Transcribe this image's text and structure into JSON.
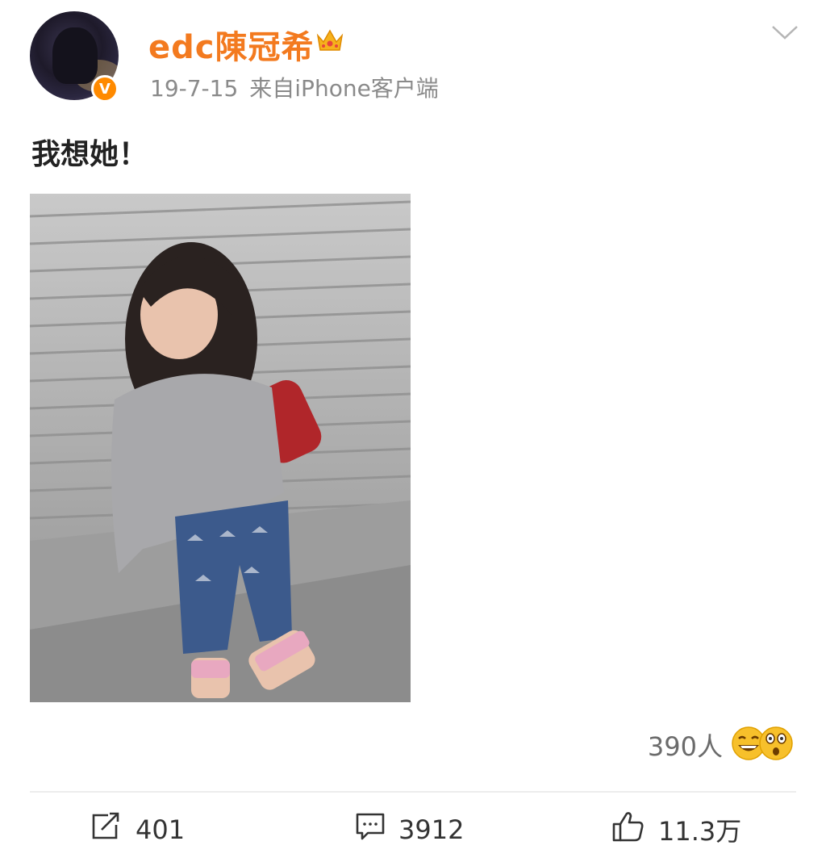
{
  "post": {
    "username": "edc陳冠希",
    "date": "19-7-15",
    "source": "来自iPhone客户端",
    "text": "我想她！",
    "verified_badge": "V",
    "icons": [
      "crown-icon",
      "verified-badge",
      "chevron-down-icon"
    ]
  },
  "reactions": {
    "count_label": "390人",
    "icons": [
      "grin-emoji-icon",
      "surprised-emoji-icon"
    ]
  },
  "actions": {
    "repost": {
      "icon": "repost-icon",
      "count": "401"
    },
    "comment": {
      "icon": "comment-icon",
      "count": "3912"
    },
    "like": {
      "icon": "thumbs-up-icon",
      "count": "11.3万"
    }
  },
  "colors": {
    "username": "#f37a1f",
    "meta": "#8a8a8a",
    "badge": "#ff8a00"
  }
}
